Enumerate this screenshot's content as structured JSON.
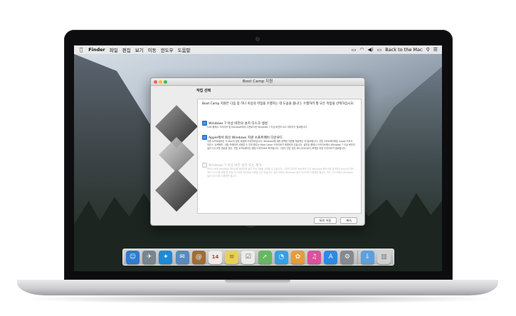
{
  "menubar": {
    "apple_icon": "apple-logo",
    "items": [
      "Finder",
      "파일",
      "편집",
      "보기",
      "이동",
      "윈도우",
      "도움말"
    ],
    "right": {
      "icons": [
        "bootcamp-icon",
        "wifi-icon",
        "volume-icon",
        "battery-icon"
      ],
      "back_to_mac": "Back to the Mac",
      "extra_icons": [
        "search-icon",
        "list-icon"
      ]
    }
  },
  "window": {
    "title": "Boot Camp 지원",
    "section_title": "작업 선택",
    "intro": "Boot Camp 지원은 다음 중 하나 이상의 작업을 수행하는 데 도움을 줍니다. 수행하려 할 모든 작업을 선택하십시오:",
    "options": [
      {
        "label": "Windows 7 이상 버전의 설치 디스크 생성",
        "checked": true,
        "enabled": true,
        "description": "USB 플래시 드라이브 및 Microsoft에서 다운로드한 Windows 7 이상 버전의 ISO 이미지가 필요합니다."
      },
      {
        "label": "Apple에서 최신 Windows 지원 소프트웨어 다운로드",
        "checked": true,
        "enabled": true,
        "description": "지원 소프트웨어는 각 Mac의 일부 특징에 드라이버입니다. Windows에 대한 완벽한 지원을 제공하는 데 필요합니다. 지원 소프트웨어에는 Apple 키보드, 마우스, 트랙패드, 내장 카메라를 사용할 수 있게 해주는 Boot Camp 드라이버가 포함되어 있습니다. 설치된 플래시 드라이브에서 Windows 7 이상 버전의 설치 디스크를 생성한 경우, 지원 소프트웨어는 해당 드라이브로 복사됩니다. 그렇지 않은 경우 MS-DOS(FAT) 포맷된 외장 드라이브가 필요합니다."
      },
      {
        "label": "Windows 7 이상 버전 설치 또는 제거",
        "checked": false,
        "enabled": false,
        "description": "파티션 후에 Windows 파티션을 생성하여 설치 프로그램을 시작할 수 있습니다. 그렇지 않으면 Mac에서 기존 Windows 파티션을 제거하여 macOS 여러 개의 디스크를 포함 한 단일 디스크를 이전대로 사용할 수도 있습니다. 설치 여부는 Windows 설치 디스크를 사용해야 합니다. 또는 디스크에서 Windows 설치 디스크를 사용하면 됩니다."
      }
    ],
    "buttons": {
      "back": "뒤로 이동",
      "continue": "계속"
    }
  },
  "dock": {
    "icons": [
      {
        "name": "finder",
        "glyph": "☺",
        "color": "#2f7fd8"
      },
      {
        "name": "launchpad",
        "glyph": "🚀",
        "color": "#7c8893"
      },
      {
        "name": "safari",
        "glyph": "✦",
        "color": "#1c8fe0"
      },
      {
        "name": "mail",
        "glyph": "✉",
        "color": "#5a8fc7"
      },
      {
        "name": "contacts",
        "glyph": "@",
        "color": "#a4703a"
      },
      {
        "name": "calendar",
        "glyph": "14",
        "color": "#f5f5f5"
      },
      {
        "name": "notes",
        "glyph": "≡",
        "color": "#f1d75a"
      },
      {
        "name": "reminders",
        "glyph": "☑",
        "color": "#f4f4f4"
      },
      {
        "name": "maps",
        "glyph": "➚",
        "color": "#6bbd63"
      },
      {
        "name": "messages",
        "glyph": "◔",
        "color": "#35a6f0"
      },
      {
        "name": "photos",
        "glyph": "✿",
        "color": "#f0a13a"
      },
      {
        "name": "itunes",
        "glyph": "♫",
        "color": "#e552a3"
      },
      {
        "name": "app-store",
        "glyph": "A",
        "color": "#2d8ef0"
      },
      {
        "name": "system-preferences",
        "glyph": "⚙",
        "color": "#8a8f96"
      },
      {
        "name": "downloads-folder",
        "glyph": "⇩",
        "color": "#5fa6e6"
      },
      {
        "name": "trash",
        "glyph": "🗑",
        "color": "#d7d9dc"
      }
    ]
  }
}
